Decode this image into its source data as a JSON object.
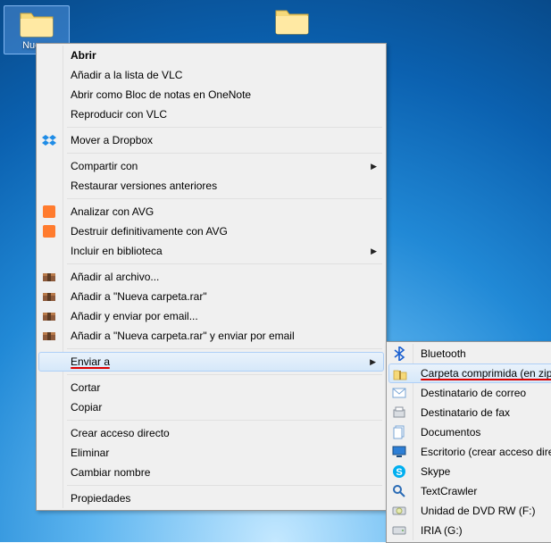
{
  "icons": {
    "left": {
      "label": "Nueva"
    },
    "right": {
      "label": ""
    }
  },
  "menu1": {
    "abrir": "Abrir",
    "vlc_list": "Añadir a la lista de VLC",
    "onenote": "Abrir como Bloc de notas en OneNote",
    "vlc_play": "Reproducir con VLC",
    "dropbox": "Mover a Dropbox",
    "compartir": "Compartir con",
    "restaurar": "Restaurar versiones anteriores",
    "avg_scan": "Analizar con AVG",
    "avg_shred": "Destruir definitivamente con AVG",
    "biblioteca": "Incluir en biblioteca",
    "rar_add": "Añadir al archivo...",
    "rar_named": "Añadir a \"Nueva carpeta.rar\"",
    "rar_email": "Añadir y enviar por email...",
    "rar_named_email": "Añadir a \"Nueva carpeta.rar\" y enviar por email",
    "enviar": "Enviar a",
    "cortar": "Cortar",
    "copiar": "Copiar",
    "acceso": "Crear acceso directo",
    "eliminar": "Eliminar",
    "renombrar": "Cambiar nombre",
    "prop": "Propiedades"
  },
  "menu2": {
    "bt": "Bluetooth",
    "zip": "Carpeta comprimida (en zip)",
    "mail": "Destinatario de correo",
    "fax": "Destinatario de fax",
    "docs": "Documentos",
    "desk": "Escritorio (crear acceso directo)",
    "skype": "Skype",
    "tc": "TextCrawler",
    "dvd": "Unidad de DVD RW (F:)",
    "iria": "IRIA (G:)"
  }
}
